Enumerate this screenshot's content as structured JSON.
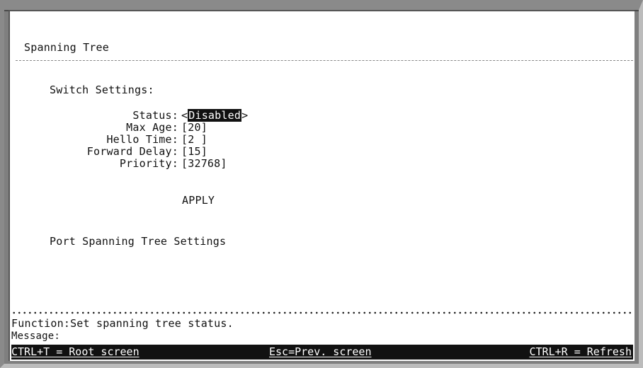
{
  "screen_title": "Spanning Tree",
  "section_switch": "Switch Settings:",
  "fields": {
    "status": {
      "label": "Status:",
      "value": "Disabled"
    },
    "max_age": {
      "label": "Max Age:",
      "value": "20"
    },
    "hello_time": {
      "label": "Hello Time:",
      "value": "2 "
    },
    "forward_delay": {
      "label": "Forward Delay:",
      "value": "15"
    },
    "priority": {
      "label": "Priority:",
      "value": "32768"
    }
  },
  "apply_label": "APPLY",
  "section_port": "Port Spanning Tree Settings",
  "function_text": "Function:Set spanning tree status.",
  "message_label": "Message:",
  "bottom_bar": {
    "root": "CTRL+T = Root screen",
    "prev": "Esc=Prev. screen",
    "refresh": "CTRL+R = Refresh"
  },
  "colors": {
    "bar_bg": "#111111",
    "bar_text": "#ffffff",
    "frame": "#8a8a8a"
  }
}
